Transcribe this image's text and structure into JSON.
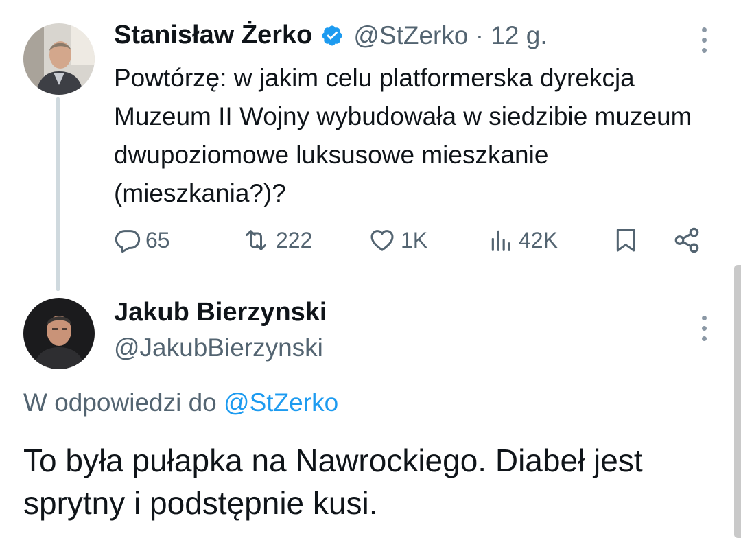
{
  "tweet1": {
    "author_name": "Stanisław Żerko",
    "verified": true,
    "handle": "@StZerko",
    "time": "· 12 g.",
    "text": "Powtórzę: w jakim celu platformerska dyrekcja Muzeum II Wojny wybudowała w siedzibie muzeum dwupoziomowe luksusowe mieszkanie (mieszkania?)?",
    "stats": {
      "replies": "65",
      "retweets": "222",
      "likes": "1K",
      "views": "42K"
    }
  },
  "tweet2": {
    "author_name": "Jakub Bierzynski",
    "handle": "@JakubBierzynski",
    "reply_prefix": "W odpowiedzi do",
    "reply_mention": "@StZerko",
    "text": "To była pułapka na Nawrockiego. Diabeł jest sprytny i podstępnie kusi."
  },
  "colors": {
    "text_primary": "#0f1419",
    "text_secondary": "#536471",
    "accent": "#1d9bf0",
    "thread_line": "#cfd9de"
  },
  "icons": [
    "verified-badge-icon",
    "reply-icon",
    "retweet-icon",
    "like-icon",
    "views-icon",
    "bookmark-icon",
    "share-icon",
    "more-options-icon"
  ]
}
